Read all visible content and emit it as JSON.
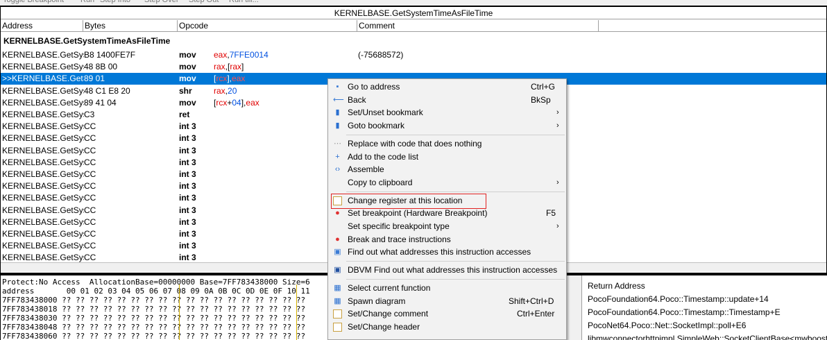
{
  "toolbar": {
    "items": [
      "Toggle Breakpoint",
      "Run",
      "Step Into",
      "Step Over",
      "Step Out",
      "Run till..."
    ]
  },
  "disassembler": {
    "title": "KERNELBASE.GetSystemTimeAsFileTime",
    "columns": [
      "Address",
      "Bytes",
      "Opcode",
      "Comment"
    ],
    "function_header": "KERNELBASE.GetSystemTimeAsFileTime",
    "rows": [
      {
        "addr": "KERNELBASE.GetSysten",
        "bytes": "B8 1400FE7F",
        "op": "mov",
        "comment": "(-75688572)",
        "args": [
          {
            "t": "eax",
            "c": "reg"
          },
          {
            "t": ",",
            "c": ""
          },
          {
            "t": "7FFE0014",
            "c": "num"
          }
        ]
      },
      {
        "addr": "KERNELBASE.GetSysten",
        "bytes": "48 8B 00",
        "op": "mov",
        "comment": "",
        "args": [
          {
            "t": "rax",
            "c": "reg"
          },
          {
            "t": ",[",
            "c": ""
          },
          {
            "t": "rax",
            "c": "reg"
          },
          {
            "t": "]",
            "c": ""
          }
        ]
      },
      {
        "addr": ">>KERNELBASE.GetSys",
        "bytes": "89 01",
        "op": "mov",
        "comment": "",
        "args": [
          {
            "t": "[",
            "c": ""
          },
          {
            "t": "rcx",
            "c": "reg"
          },
          {
            "t": "],",
            "c": ""
          },
          {
            "t": "eax",
            "c": "reg"
          }
        ],
        "selected": true
      },
      {
        "addr": "KERNELBASE.GetSysten",
        "bytes": "48 C1 E8 20",
        "op": "shr",
        "comment": "",
        "args": [
          {
            "t": "rax",
            "c": "reg"
          },
          {
            "t": ",",
            "c": ""
          },
          {
            "t": "20",
            "c": "num"
          }
        ]
      },
      {
        "addr": "KERNELBASE.GetSysten",
        "bytes": "89 41 04",
        "op": "mov",
        "comment": "",
        "args": [
          {
            "t": "[",
            "c": ""
          },
          {
            "t": "rcx",
            "c": "reg"
          },
          {
            "t": "+",
            "c": ""
          },
          {
            "t": "04",
            "c": "num"
          },
          {
            "t": "],",
            "c": ""
          },
          {
            "t": "eax",
            "c": "reg"
          }
        ]
      },
      {
        "addr": "KERNELBASE.GetSysten",
        "bytes": "C3",
        "op": "ret",
        "comment": "",
        "args": []
      },
      {
        "addr": "KERNELBASE.GetSysten",
        "bytes": "CC",
        "op": "int 3",
        "comment": "",
        "args": []
      },
      {
        "addr": "KERNELBASE.GetSysten",
        "bytes": "CC",
        "op": "int 3",
        "comment": "",
        "args": []
      },
      {
        "addr": "KERNELBASE.GetSysten",
        "bytes": "CC",
        "op": "int 3",
        "comment": "",
        "args": []
      },
      {
        "addr": "KERNELBASE.GetSysten",
        "bytes": "CC",
        "op": "int 3",
        "comment": "",
        "args": []
      },
      {
        "addr": "KERNELBASE.GetSysten",
        "bytes": "CC",
        "op": "int 3",
        "comment": "",
        "args": []
      },
      {
        "addr": "KERNELBASE.GetSysten",
        "bytes": "CC",
        "op": "int 3",
        "comment": "",
        "args": []
      },
      {
        "addr": "KERNELBASE.GetSysten",
        "bytes": "CC",
        "op": "int 3",
        "comment": "",
        "args": []
      },
      {
        "addr": "KERNELBASE.GetSysten",
        "bytes": "CC",
        "op": "int 3",
        "comment": "",
        "args": []
      },
      {
        "addr": "KERNELBASE.GetSysten",
        "bytes": "CC",
        "op": "int 3",
        "comment": "",
        "args": []
      },
      {
        "addr": "KERNELBASE.GetSysten",
        "bytes": "CC",
        "op": "int 3",
        "comment": "",
        "args": []
      },
      {
        "addr": "KERNELBASE.GetSysten",
        "bytes": "CC",
        "op": "int 3",
        "comment": "",
        "args": []
      },
      {
        "addr": "KERNELBASE.GetSysten",
        "bytes": "CC",
        "op": "int 3",
        "comment": "",
        "args": []
      }
    ]
  },
  "hexview": {
    "info_line": "Protect:No Access  AllocationBase=00000000 Base=7FF783438000 Size=6",
    "header_line": "address       00 01 02 03 04 05 06 07 08 09 0A 0B 0C 0D 0E 0F 10 11",
    "lines": [
      "7FF783438000 ?? ?? ?? ?? ?? ?? ?? ?? ?? ?? ?? ?? ?? ?? ?? ?? ?? ??",
      "7FF783438018 ?? ?? ?? ?? ?? ?? ?? ?? ?? ?? ?? ?? ?? ?? ?? ?? ?? ??",
      "7FF783438030 ?? ?? ?? ?? ?? ?? ?? ?? ?? ?? ?? ?? ?? ?? ?? ?? ?? ??",
      "7FF783438048 ?? ?? ?? ?? ?? ?? ?? ?? ?? ?? ?? ?? ?? ?? ?? ?? ?? ??",
      "7FF783438060 ?? ?? ?? ?? ?? ?? ?? ?? ?? ?? ?? ?? ?? ?? ?? ?? ?? ??"
    ]
  },
  "returnstack": {
    "header": "Return Address",
    "items": [
      "PocoFoundation64.Poco::Timestamp::update+14",
      "PocoFoundation64.Poco::Timestamp::Timestamp+E",
      "PocoNet64.Poco::Net::SocketImpl::poll+E6",
      "libmwconnectorhttpimpl.SimpleWeb::SocketClientBase<mwboost::"
    ]
  },
  "context_menu": {
    "items": [
      {
        "label": "Go to address",
        "shortcut": "Ctrl+G",
        "icon": "goto-address-icon",
        "glyph": "▪",
        "color": "#3a7bd5",
        "submenu": false
      },
      {
        "label": "Back",
        "shortcut": "BkSp",
        "icon": "back-arrow-icon",
        "glyph": "⟵",
        "color": "#3a7bd5",
        "submenu": false
      },
      {
        "label": "Set/Unset bookmark",
        "shortcut": "",
        "icon": "bookmark-icon",
        "glyph": "▮",
        "color": "#2a6fd0",
        "submenu": true
      },
      {
        "label": "Goto bookmark",
        "shortcut": "",
        "icon": "goto-bookmark-icon",
        "glyph": "▮",
        "color": "#2a6fd0",
        "submenu": true
      },
      {
        "sep": true
      },
      {
        "label": "Replace with code that does nothing",
        "shortcut": "",
        "icon": "nop-icon",
        "glyph": "⋯",
        "color": "#999999",
        "submenu": false
      },
      {
        "label": "Add to the code list",
        "shortcut": "",
        "icon": "plus-icon",
        "glyph": "+",
        "color": "#2a6fd0",
        "submenu": false
      },
      {
        "label": "Assemble",
        "shortcut": "",
        "icon": "assemble-icon",
        "glyph": "‹›",
        "color": "#2a6fd0",
        "submenu": false
      },
      {
        "label": "Copy to clipboard",
        "shortcut": "",
        "icon": "copy-icon",
        "glyph": "",
        "color": "#f2f2f2",
        "submenu": true
      },
      {
        "sep": true
      },
      {
        "label": "Change register at this location",
        "shortcut": "",
        "icon": "document-icon",
        "glyph": "",
        "color": "#ffffff",
        "submenu": false,
        "highlight": true
      },
      {
        "label": "Set breakpoint (Hardware Breakpoint)",
        "shortcut": "F5",
        "icon": "breakpoint-icon",
        "glyph": "●",
        "color": "#e03030",
        "submenu": false
      },
      {
        "label": "Set specific breakpoint type",
        "shortcut": "",
        "icon": "breakpoint-type-icon",
        "glyph": "",
        "color": "#f2f2f2",
        "submenu": true
      },
      {
        "label": "Break and trace instructions",
        "shortcut": "",
        "icon": "trace-icon",
        "glyph": "●",
        "color": "#e03030",
        "submenu": false
      },
      {
        "label": "Find out what addresses this instruction accesses",
        "shortcut": "",
        "icon": "find-addresses-icon",
        "glyph": "▣",
        "color": "#3a7bd5",
        "submenu": false
      },
      {
        "sep": true
      },
      {
        "label": "DBVM Find out what addresses this instruction accesses",
        "shortcut": "",
        "icon": "dbvm-icon",
        "glyph": "▣",
        "color": "#2050a0",
        "submenu": false
      },
      {
        "sep": true
      },
      {
        "label": "Select current function",
        "shortcut": "",
        "icon": "select-function-icon",
        "glyph": "▦",
        "color": "#2a6fd0",
        "submenu": false
      },
      {
        "label": "Spawn diagram",
        "shortcut": "Shift+Ctrl+D",
        "icon": "diagram-icon",
        "glyph": "▦",
        "color": "#2a6fd0",
        "submenu": false
      },
      {
        "label": "Set/Change comment",
        "shortcut": "Ctrl+Enter",
        "icon": "comment-icon",
        "glyph": "",
        "color": "#ffffff",
        "submenu": false
      },
      {
        "label": "Set/Change header",
        "shortcut": "",
        "icon": "header-icon",
        "glyph": "",
        "color": "#ffffff",
        "submenu": false
      }
    ]
  }
}
